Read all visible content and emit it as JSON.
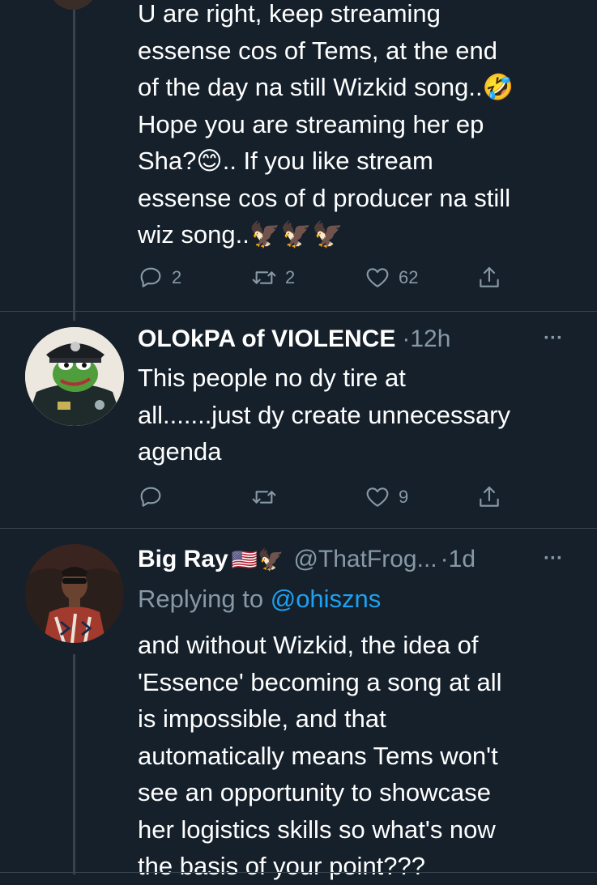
{
  "tweets": [
    {
      "text": "U are right, keep streaming\nessense cos of Tems, at the end\nof the day na still Wizkid song..🤣\nHope you are streaming her ep\nSha?😊.. If you like stream\nessense cos of d producer na still\nwiz song..🦅🦅🦅",
      "replies": "2",
      "retweets": "2",
      "likes": "62"
    },
    {
      "name": "OLOkPA of VIOLENCE",
      "time": "·12h",
      "text": "This people no dy tire at\nall.......just dy create unnecessary\nagenda",
      "replies": "",
      "retweets": "",
      "likes": "9"
    },
    {
      "name": "Big Ray",
      "emojis": "🇺🇸🦅",
      "handle": "@ThatFrog...",
      "time": "·1d",
      "replying_prefix": "Replying to ",
      "replying_handle": "@ohiszns",
      "text": "and without Wizkid, the idea of\n'Essence' becoming a song at all\nis impossible, and that\nautomatically means Tems won't\nsee an opportunity to showcase\nher logistics skills so what's now\nthe basis of your point???"
    }
  ],
  "more_glyph": "···",
  "colors": {
    "background": "#15202b",
    "text": "#ffffff",
    "muted": "#8899a6",
    "link": "#1da1f2",
    "border": "#38444d"
  }
}
